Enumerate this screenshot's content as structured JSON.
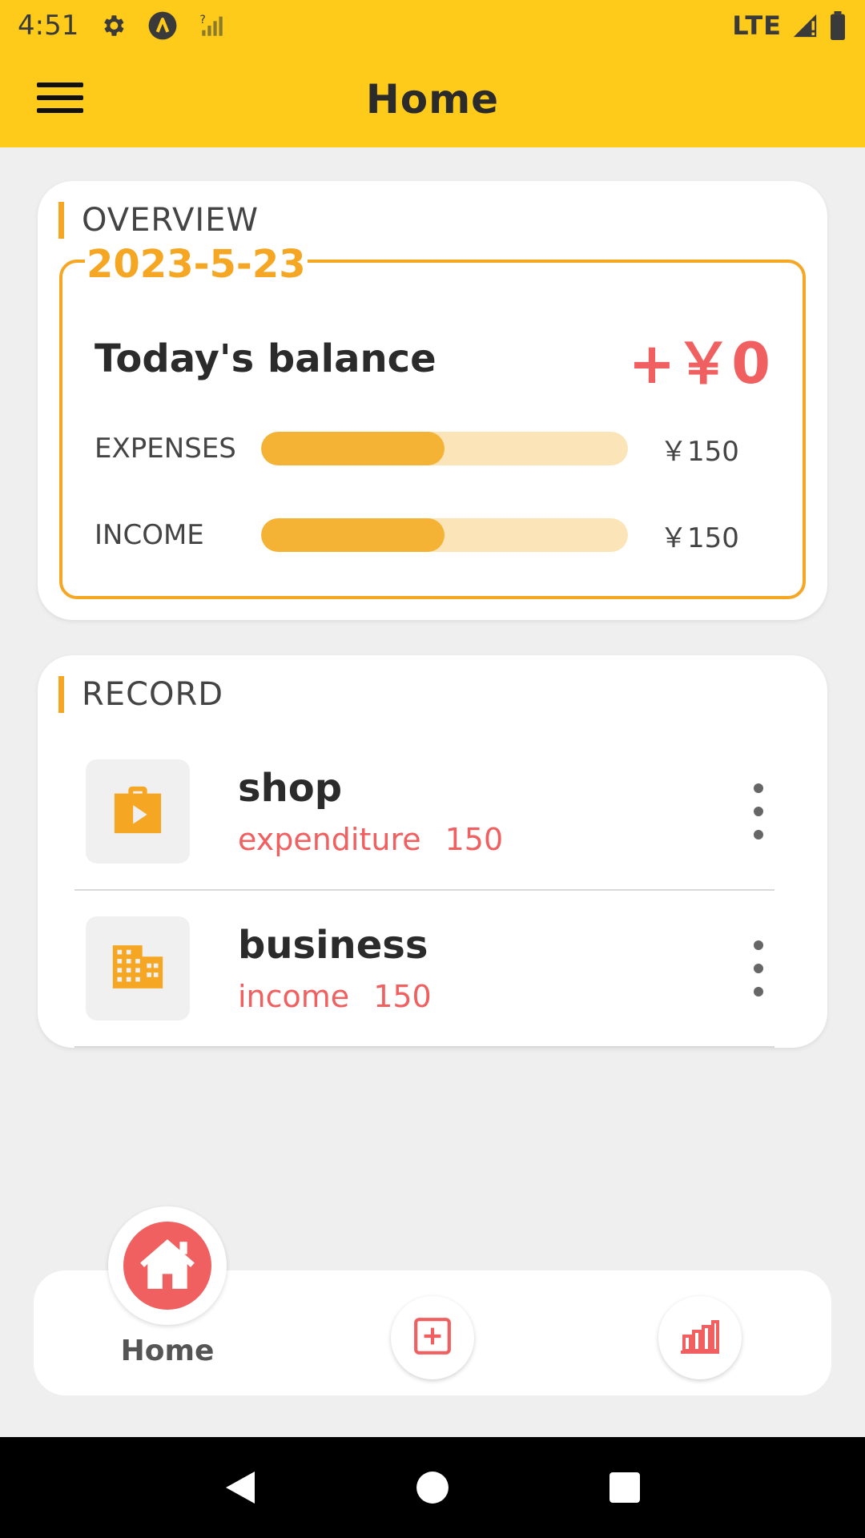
{
  "status_bar": {
    "time": "4:51",
    "network": "LTE",
    "icons": [
      "settings-icon",
      "at-icon",
      "no-signal-icon",
      "lte-signal-icon",
      "battery-icon"
    ]
  },
  "app_bar": {
    "title": "Home",
    "menu_icon": "hamburger-menu-icon"
  },
  "overview": {
    "title": "OVERVIEW",
    "date": "2023-5-23",
    "balance_label": "Today's balance",
    "balance_value": "+￥0",
    "expenses": {
      "label": "EXPENSES",
      "amount": "￥150",
      "progress": 0.5
    },
    "income": {
      "label": "INCOME",
      "amount": "￥150",
      "progress": 0.5
    }
  },
  "record": {
    "title": "RECORD",
    "items": [
      {
        "name": "shop",
        "type": "expenditure",
        "amount": "150",
        "icon": "shopping-bag-icon"
      },
      {
        "name": "business",
        "type": "income",
        "amount": "150",
        "icon": "building-icon"
      }
    ]
  },
  "bottom_nav": {
    "home_label": "Home",
    "items": [
      "home-icon",
      "add-icon",
      "bar-chart-icon"
    ]
  },
  "colors": {
    "primary_yellow": "#FECB1A",
    "accent_orange": "#F5A623",
    "accent_red": "#F06060",
    "bar_track": "#FBE5B8",
    "bar_fill": "#F5B335"
  }
}
